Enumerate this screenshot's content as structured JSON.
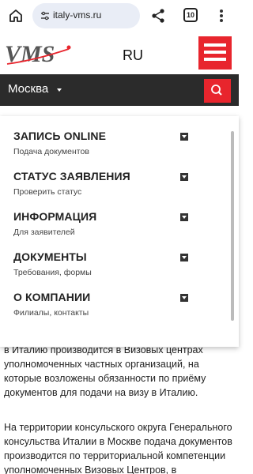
{
  "browser": {
    "url": "italy-vms.ru",
    "tab_count": "10",
    "icons": [
      "home-icon",
      "site-info-icon",
      "share-icon",
      "tabs-icon",
      "more-menu-icon"
    ]
  },
  "header": {
    "logo_text": "VMS",
    "language": "RU",
    "accent_color": "#e8252d"
  },
  "city_bar": {
    "city": "Москва",
    "bar_color": "#2b2b2b"
  },
  "menu": {
    "items": [
      {
        "title": "ЗАПИСЬ ONLINE",
        "subtitle": "Подача документов"
      },
      {
        "title": "СТАТУС ЗАЯВЛЕНИЯ",
        "subtitle": "Проверить статус"
      },
      {
        "title": "ИНФОРМАЦИЯ",
        "subtitle": "Для заявителей"
      },
      {
        "title": "ДОКУМЕНТЫ",
        "subtitle": "Требования, формы"
      },
      {
        "title": "О КОМПАНИИ",
        "subtitle": "Филиалы, контакты"
      }
    ]
  },
  "article": {
    "paragraph1": "в Италию производится в Визовых центрах уполномоченных частных организаций, на которые возложены обязанности по приёму документов для подачи на визу в Италию.",
    "paragraph2": "На территории консульского округа Генерального консульства Италии в Москве подача документов производится по территориальной компетенции уполномоченных Визовых Центров, в соответствии"
  }
}
